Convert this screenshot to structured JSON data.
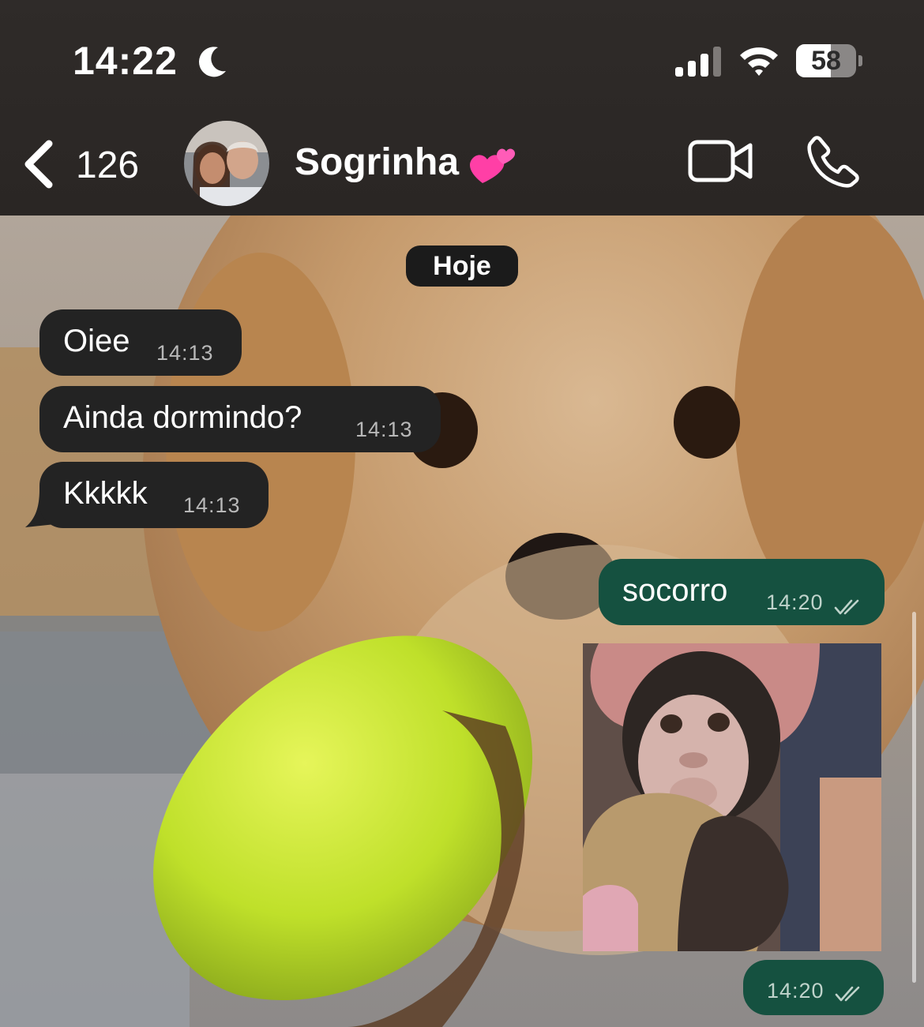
{
  "status_bar": {
    "time": "14:22",
    "battery": "58",
    "battery_fraction": 0.58
  },
  "header": {
    "back_count": "126",
    "contact_name": "Sogrinha",
    "name_emoji_icon": "two-hearts-icon"
  },
  "chat": {
    "date_label": "Hoje",
    "messages": [
      {
        "direction": "incoming",
        "text": "Oiee",
        "time": "14:13"
      },
      {
        "direction": "incoming",
        "text": "Ainda dormindo?",
        "time": "14:13"
      },
      {
        "direction": "incoming",
        "text": "Kkkkk",
        "time": "14:13"
      },
      {
        "direction": "outgoing",
        "text": "socorro",
        "time": "14:20",
        "status_icon": "double-check-icon"
      },
      {
        "direction": "outgoing",
        "type": "image",
        "time": "14:20",
        "status_icon": "double-check-icon"
      }
    ]
  },
  "colors": {
    "incoming_bubble": "#232323",
    "outgoing_bubble": "#155140",
    "header_background": "#2c2826"
  }
}
